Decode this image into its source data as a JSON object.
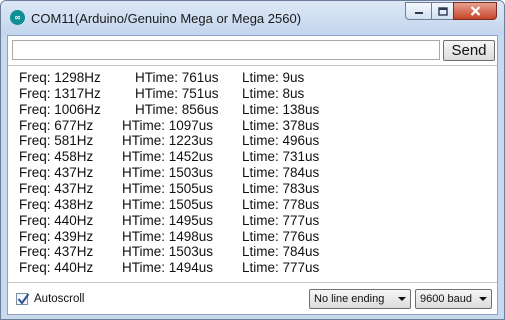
{
  "window": {
    "title": "COM11(Arduino/Genuino Mega or Mega 2560)",
    "icon": "arduino-icon"
  },
  "input": {
    "value": "",
    "placeholder": ""
  },
  "send_label": "Send",
  "lines": [
    {
      "freq": "Freq: 1298Hz",
      "htime": "HTime: 761us",
      "ltime": "Ltime:  9us"
    },
    {
      "freq": "Freq: 1317Hz",
      "htime": "HTime: 751us",
      "ltime": "Ltime:  8us"
    },
    {
      "freq": "Freq: 1006Hz",
      "htime": "HTime: 856us",
      "ltime": "Ltime:  138us"
    },
    {
      "freq": "Freq: 677Hz",
      "htime": "HTime: 1097us",
      "ltime": "Ltime:  378us"
    },
    {
      "freq": "Freq: 581Hz",
      "htime": "HTime: 1223us",
      "ltime": "Ltime:  496us"
    },
    {
      "freq": "Freq: 458Hz",
      "htime": "HTime: 1452us",
      "ltime": "Ltime:  731us"
    },
    {
      "freq": "Freq: 437Hz",
      "htime": "HTime: 1503us",
      "ltime": "Ltime:  784us"
    },
    {
      "freq": "Freq: 437Hz",
      "htime": "HTime: 1505us",
      "ltime": "Ltime:  783us"
    },
    {
      "freq": "Freq: 438Hz",
      "htime": "HTime: 1505us",
      "ltime": "Ltime:  778us"
    },
    {
      "freq": "Freq: 440Hz",
      "htime": "HTime: 1495us",
      "ltime": "Ltime:  777us"
    },
    {
      "freq": "Freq: 439Hz",
      "htime": "HTime: 1498us",
      "ltime": "Ltime:  776us"
    },
    {
      "freq": "Freq: 437Hz",
      "htime": "HTime: 1503us",
      "ltime": "Ltime:  784us"
    },
    {
      "freq": "Freq: 440Hz",
      "htime": "HTime: 1494us",
      "ltime": "Ltime:  777us"
    }
  ],
  "footer": {
    "autoscroll_label": "Autoscroll",
    "autoscroll_checked": true,
    "line_ending": "No line ending",
    "baud": "9600 baud"
  },
  "colors": {
    "titlebar": "#c9d9ee",
    "close_button": "#c8452b",
    "checkmark": "#2a4f96"
  }
}
